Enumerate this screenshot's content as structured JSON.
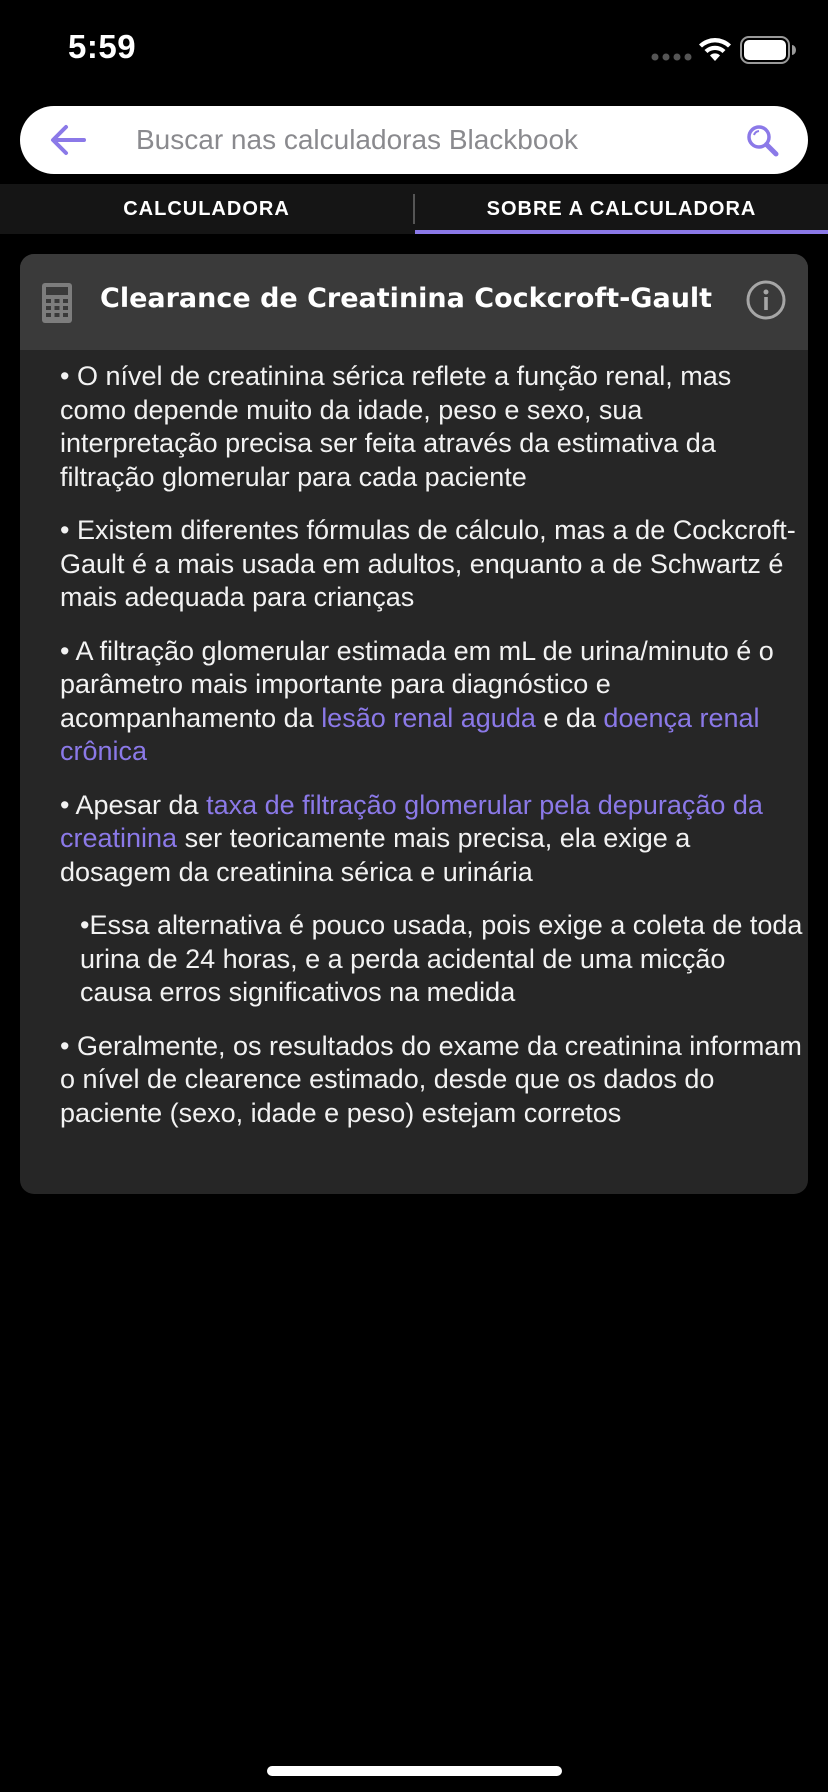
{
  "status_bar": {
    "time": "5:59"
  },
  "search": {
    "placeholder": "Buscar nas calculadoras Blackbook",
    "value": ""
  },
  "tabs": [
    {
      "label": "CALCULADORA",
      "active": false
    },
    {
      "label": "SOBRE A CALCULADORA",
      "active": true
    }
  ],
  "card": {
    "title": "Clearance de Creatinina Cockcroft-Gault",
    "paragraphs": [
      {
        "text": "• O nível de creatinina sérica reflete a função renal, mas como depende muito da idade, peso e sexo, sua interpretação precisa ser feita através da estimativa da filtração glomerular para cada paciente"
      },
      {
        "text": "• Existem diferentes fórmulas de cálculo, mas a de Cockcroft-Gault é a mais usada em adultos, enquanto a de Schwartz é mais adequada para crianças"
      },
      {
        "pre": "• A filtração glomerular estimada em mL de urina/minuto é o parâmetro mais importante para diagnóstico e acompanhamento da ",
        "link1": "lesão renal aguda",
        "mid": " e da ",
        "link2": "doença renal crônica"
      },
      {
        "pre": "• Apesar da ",
        "link1": "taxa de filtração glomerular pela depuração da creatinina",
        "post": " ser teoricamente mais precisa, ela exige a dosagem da creatinina sérica e urinária"
      },
      {
        "text": "•Essa alternativa é pouco usada, pois exige a coleta de toda urina de 24 horas, e a perda acidental de uma micção causa erros significativos na medida"
      },
      {
        "text": "• Geralmente, os resultados do exame da creatinina informam o nível de clearence estimado, desde que os dados do paciente (sexo, idade e peso) estejam corretos"
      }
    ]
  },
  "colors": {
    "accent": "#8b79e8",
    "background": "#000000",
    "card": "#262626",
    "card_header": "#3a3a3a"
  },
  "icons": {
    "back": "arrow-left-icon",
    "search": "magnifier-icon",
    "calculator": "calculator-icon",
    "info": "info-circle-icon"
  }
}
